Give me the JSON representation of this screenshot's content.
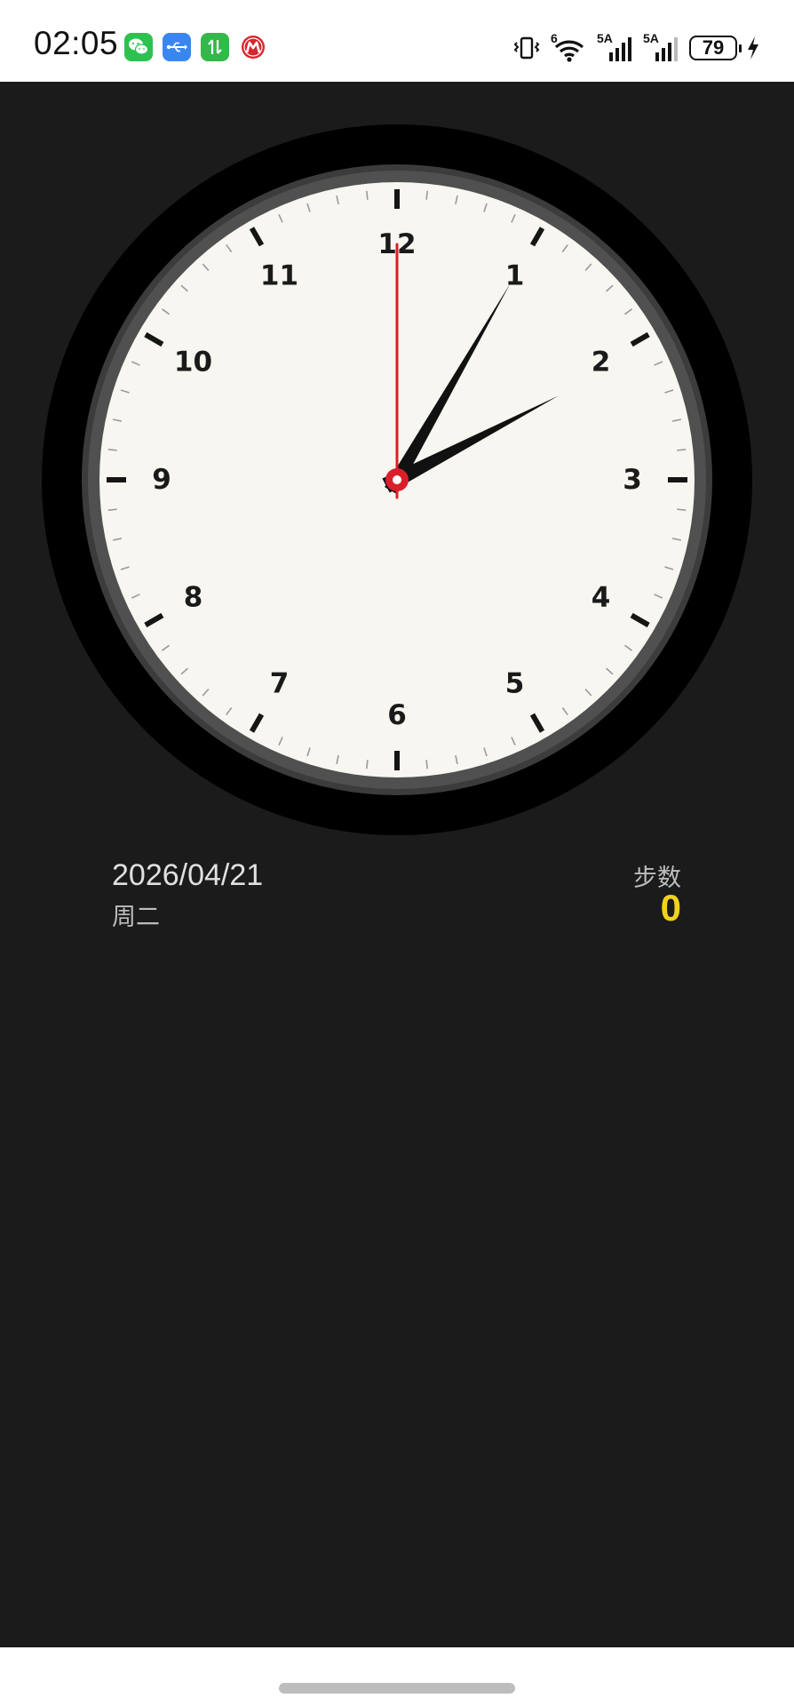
{
  "status_bar": {
    "time": "02:05",
    "notification_icons": [
      "wechat-icon",
      "usb-icon",
      "data-transfer-icon",
      "bank-app-icon"
    ],
    "signal_1_label": "5A",
    "signal_2_label": "5A",
    "wifi_label": "6",
    "battery_level": "79",
    "charging": true
  },
  "clock": {
    "hour_numbers": [
      "12",
      "1",
      "2",
      "3",
      "4",
      "5",
      "6",
      "7",
      "8",
      "9",
      "10",
      "11"
    ],
    "time": {
      "hours": 2,
      "minutes": 5,
      "seconds": 0
    },
    "colors": {
      "face": "#f7f6f0",
      "rim": "#4a4a4a",
      "outer_ring": "#000000",
      "hands": "#111111",
      "second_hand": "#d9202a"
    }
  },
  "info": {
    "date": "2026/04/21",
    "weekday": "周二",
    "steps_label": "步数",
    "steps_value": "0",
    "steps_color": "#f2d21a"
  }
}
